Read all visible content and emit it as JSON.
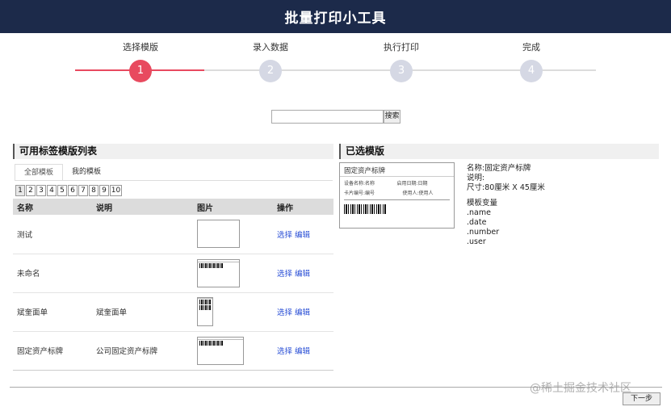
{
  "header": {
    "title": "批量打印小工具"
  },
  "steps": [
    {
      "label": "选择模版",
      "num": "1"
    },
    {
      "label": "录入数据",
      "num": "2"
    },
    {
      "label": "执行打印",
      "num": "3"
    },
    {
      "label": "完成",
      "num": "4"
    }
  ],
  "search": {
    "button": "搜索"
  },
  "left": {
    "heading": "可用标签模版列表",
    "tabs": [
      "全部模板",
      "我的模板"
    ],
    "pages": [
      "1",
      "2",
      "3",
      "4",
      "5",
      "6",
      "7",
      "8",
      "9",
      "10"
    ],
    "columns": [
      "名称",
      "说明",
      "图片",
      "操作"
    ],
    "rows": [
      {
        "name": "测试",
        "desc": ""
      },
      {
        "name": "未命名",
        "desc": ""
      },
      {
        "name": "斌奎面单",
        "desc": "斌奎面单"
      },
      {
        "name": "固定资产标牌",
        "desc": "公司固定资产标牌"
      }
    ],
    "op_select": "选择",
    "op_edit": "编辑"
  },
  "right": {
    "heading": "已选模版",
    "preview": {
      "title": "固定资产标牌",
      "r1a": "设备名称:名称",
      "r1b": "启用日期:日期",
      "r2a": "卡片编号:编号",
      "r2b": "使用人:使用人"
    },
    "info": {
      "name": "名称:固定资产标牌",
      "desc": "说明:",
      "size": "尺寸:80厘米 X 45厘米",
      "vars_title": "模板变量",
      "vars": [
        ".name",
        ".date",
        ".number",
        ".user"
      ]
    }
  },
  "footer": {
    "next": "下一步",
    "watermark": "@稀土掘金技术社区"
  },
  "colors": {
    "header": "#1c2a4a",
    "accent": "#e84a5f",
    "inactive": "#d5d8e4"
  }
}
